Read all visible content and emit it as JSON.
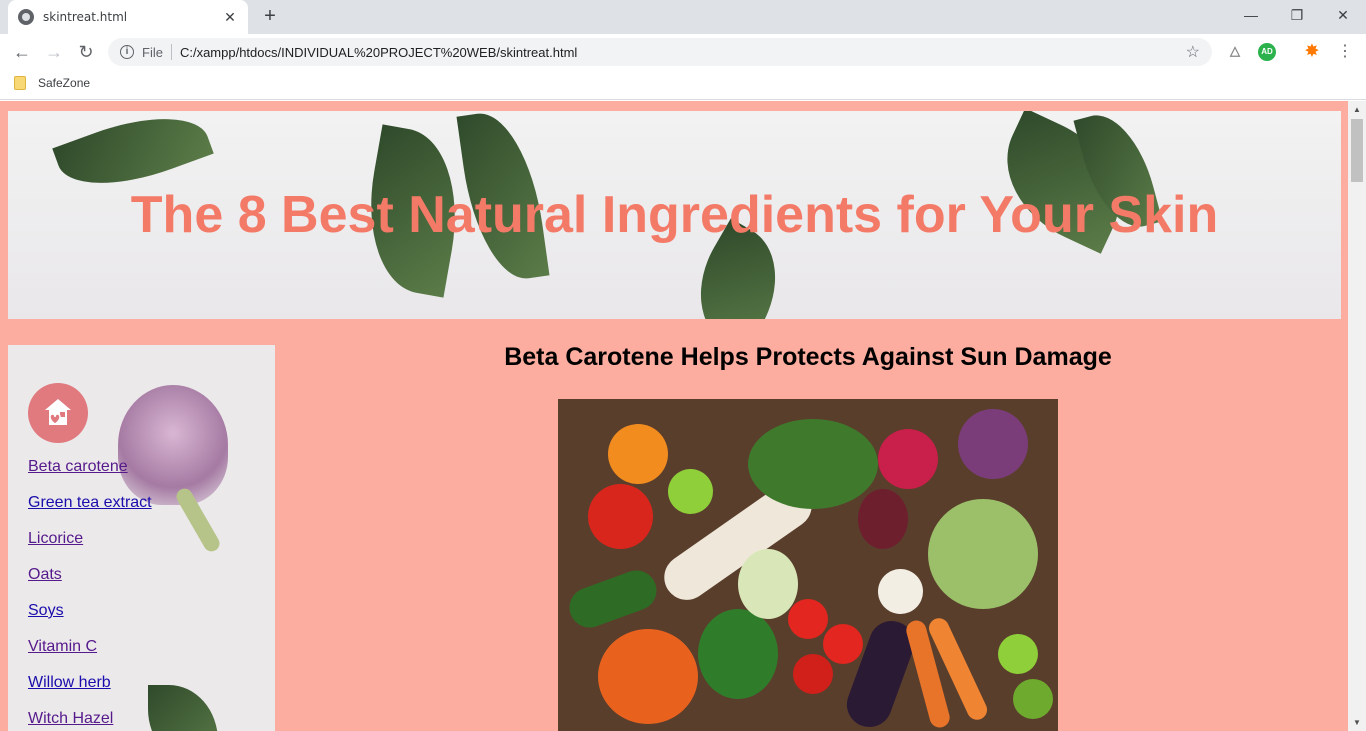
{
  "browser": {
    "tab_title": "skintreat.html",
    "tab_close": "✕",
    "new_tab": "+",
    "window_controls": {
      "minimize": "—",
      "restore": "❐",
      "close": "✕"
    },
    "nav": {
      "back": "←",
      "forward": "→",
      "reload": "↻"
    },
    "omnibox": {
      "info": "i",
      "file_label": "File",
      "url": "C:/xampp/htdocs/INDIVIDUAL%20PROJECT%20WEB/skintreat.html",
      "star": "☆"
    },
    "extensions": [
      {
        "name": "drive-icon",
        "text": "△"
      },
      {
        "name": "adguard-icon",
        "text": "AD"
      },
      {
        "name": "avast-icon",
        "text": "✸"
      }
    ],
    "menu": "⋮",
    "bookmarks": [
      {
        "label": "SafeZone"
      }
    ]
  },
  "page": {
    "banner_title": "The 8 Best Natural Ingredients for Your Skin",
    "sidebar": {
      "links": [
        {
          "label": "Beta carotene",
          "visited": true
        },
        {
          "label": "Green tea extract",
          "visited": false
        },
        {
          "label": "Licorice",
          "visited": true
        },
        {
          "label": "Oats",
          "visited": true
        },
        {
          "label": "Soys",
          "visited": false
        },
        {
          "label": "Vitamin C",
          "visited": true
        },
        {
          "label": "Willow herb",
          "visited": false
        },
        {
          "label": "Witch Hazel",
          "visited": true
        }
      ]
    },
    "section_heading": "Beta Carotene Helps Protects Against Sun Damage"
  },
  "colors": {
    "page_background": "#fcada0",
    "banner_title": "#f47a68",
    "home_icon_bg": "#e07a7f",
    "link": "#1a0dab",
    "link_visited": "#551a8b"
  }
}
